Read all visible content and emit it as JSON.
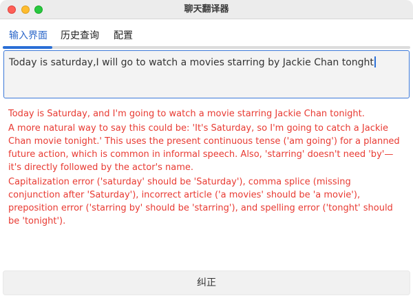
{
  "window": {
    "title": "聊天翻译器"
  },
  "tabs": [
    {
      "label": "输入界面",
      "active": true
    },
    {
      "label": "历史查询",
      "active": false
    },
    {
      "label": "配置",
      "active": false
    }
  ],
  "input": {
    "value": "Today is saturday,I will go to watch a movies starring by Jackie Chan tonght"
  },
  "output": {
    "corrected": "Today is Saturday, and I'm going to watch a movie starring Jackie Chan tonight.",
    "natural": "A more natural way to say this could be: 'It's Saturday, so I'm going to catch a Jackie Chan movie tonight.' This uses the present continuous tense ('am going') for a planned future action, which is common in informal speech. Also, 'starring' doesn't need 'by'—it's directly followed by the actor's name.",
    "errors": "Capitalization error ('saturday' should be 'Saturday'), comma splice (missing conjunction after 'Saturday'), incorrect article ('a movies' should be 'a movie'), preposition error ('starring by' should be 'starring'), and spelling error ('tonght' should be 'tonight')."
  },
  "buttons": {
    "correct_label": "纠正"
  },
  "colors": {
    "accent": "#2a6fd6",
    "output_text": "#e83a32"
  }
}
